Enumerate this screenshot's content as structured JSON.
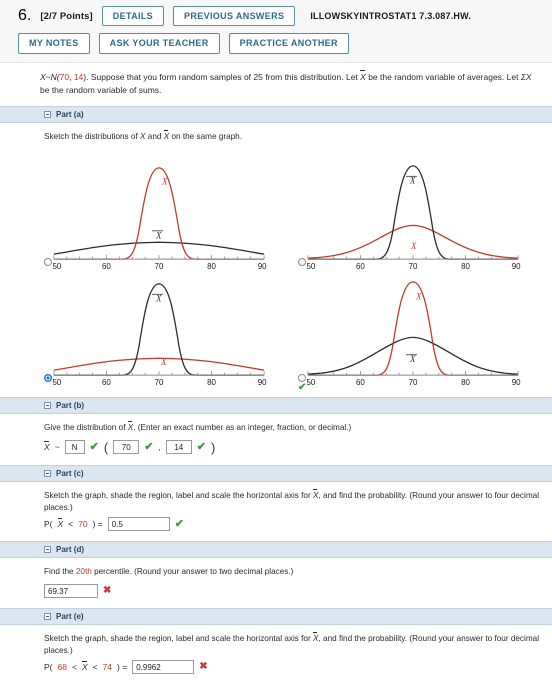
{
  "header": {
    "question_number": "6.",
    "points": "[2/7 Points]",
    "details_label": "DETAILS",
    "previous_answers_label": "PREVIOUS ANSWERS",
    "module_name": "ILLOWSKYINTROSTAT1 7.3.087.HW.",
    "my_notes_label": "MY NOTES",
    "ask_teacher_label": "ASK YOUR TEACHER",
    "practice_another_label": "PRACTICE ANOTHER"
  },
  "statement": {
    "var": "X",
    "tilde": "~",
    "dist_open": "N(",
    "mean": "70",
    "comma": ", ",
    "sd": "14",
    "dist_close": ").",
    "text_1": " Suppose that you form random samples of 25 from this distribution. Let ",
    "xbar": "X",
    "text_2": " be the random variable of averages. Let ",
    "sigmax": "ΣX",
    "text_3": " be the random variable of sums."
  },
  "parts": {
    "a": {
      "bar_label": "Part (a)",
      "prompt_1": "Sketch the distributions of ",
      "prompt_x": "X",
      "prompt_2": " and ",
      "prompt_xbar": "X",
      "prompt_3": " on the same graph.",
      "choices": [
        {
          "id": "choice-1",
          "selected": false,
          "marked_correct": false,
          "red_curve": "narrow",
          "black_curve": "wide",
          "red_label": "X",
          "black_label": "X",
          "red_label_x": 70,
          "black_label_x": 70
        },
        {
          "id": "choice-2",
          "selected": false,
          "marked_correct": false,
          "red_curve": "medium",
          "black_curve": "narrow",
          "red_label": "X",
          "black_label": "X",
          "red_label_x": 70,
          "black_label_x": 70
        },
        {
          "id": "choice-3",
          "selected": true,
          "marked_correct": false,
          "red_curve": "wide",
          "black_curve": "narrow",
          "red_label": "X",
          "black_label": "X",
          "red_label_x": 70,
          "black_label_x": 70
        },
        {
          "id": "choice-4",
          "selected": false,
          "marked_correct": true,
          "red_curve": "narrow",
          "black_curve": "medium",
          "red_label": "X",
          "black_label": "X",
          "red_label_x": 70,
          "black_label_x": 70
        }
      ],
      "axis_ticks": [
        "50",
        "60",
        "70",
        "80",
        "90"
      ]
    },
    "b": {
      "bar_label": "Part (b)",
      "prompt_1": "Give the distribution of ",
      "prompt_xbar": "X",
      "prompt_2": ". (Enter an exact number as an integer, fraction, or decimal.)",
      "lhs_xbar": "X",
      "tilde": "~",
      "dist_value": "N",
      "mean_value": "70",
      "sd_value": "14",
      "comma": ",",
      "open_paren": "(",
      "close_paren": ")",
      "status_dist": "correct",
      "status_mean": "correct",
      "status_sd": "correct"
    },
    "c": {
      "bar_label": "Part (c)",
      "prompt_1": "Sketch the graph, shade the region, label and scale the horizontal axis for ",
      "prompt_xbar": "X",
      "prompt_2": ", and find the probability. (Round your answer to four decimal places.)",
      "expr_open": "P(",
      "expr_xbar": "X",
      "expr_mid": " < ",
      "expr_bound": "70",
      "expr_close": ") = ",
      "answer": "0.5",
      "status": "correct"
    },
    "d": {
      "bar_label": "Part (d)",
      "prompt_1": "Find the ",
      "prompt_percentile": "20th",
      "prompt_2": " percentile. (Round your answer to two decimal places.)",
      "answer": "69.37",
      "status": "incorrect"
    },
    "e": {
      "bar_label": "Part (e)",
      "prompt_1": "Sketch the graph, shade the region, label and scale the horizontal axis for ",
      "prompt_xbar": "X",
      "prompt_2": ", and find the probability. (Round your answer to four decimal places.)",
      "expr_open": "P(",
      "expr_lower": "68",
      "expr_mid1": " < ",
      "expr_xbar": "X",
      "expr_mid2": " < ",
      "expr_upper": "74",
      "expr_close": ") = ",
      "answer": "0.9962",
      "status": "incorrect"
    }
  },
  "colors": {
    "red_curve": "#c0392b",
    "black_curve": "#2b2b2b",
    "correct": "#3b9b3b",
    "incorrect": "#d13838",
    "accent_blue": "#2d6b8a",
    "part_bar": "#dce6f1"
  },
  "icons": {
    "correct": "✔",
    "incorrect": "✖"
  }
}
